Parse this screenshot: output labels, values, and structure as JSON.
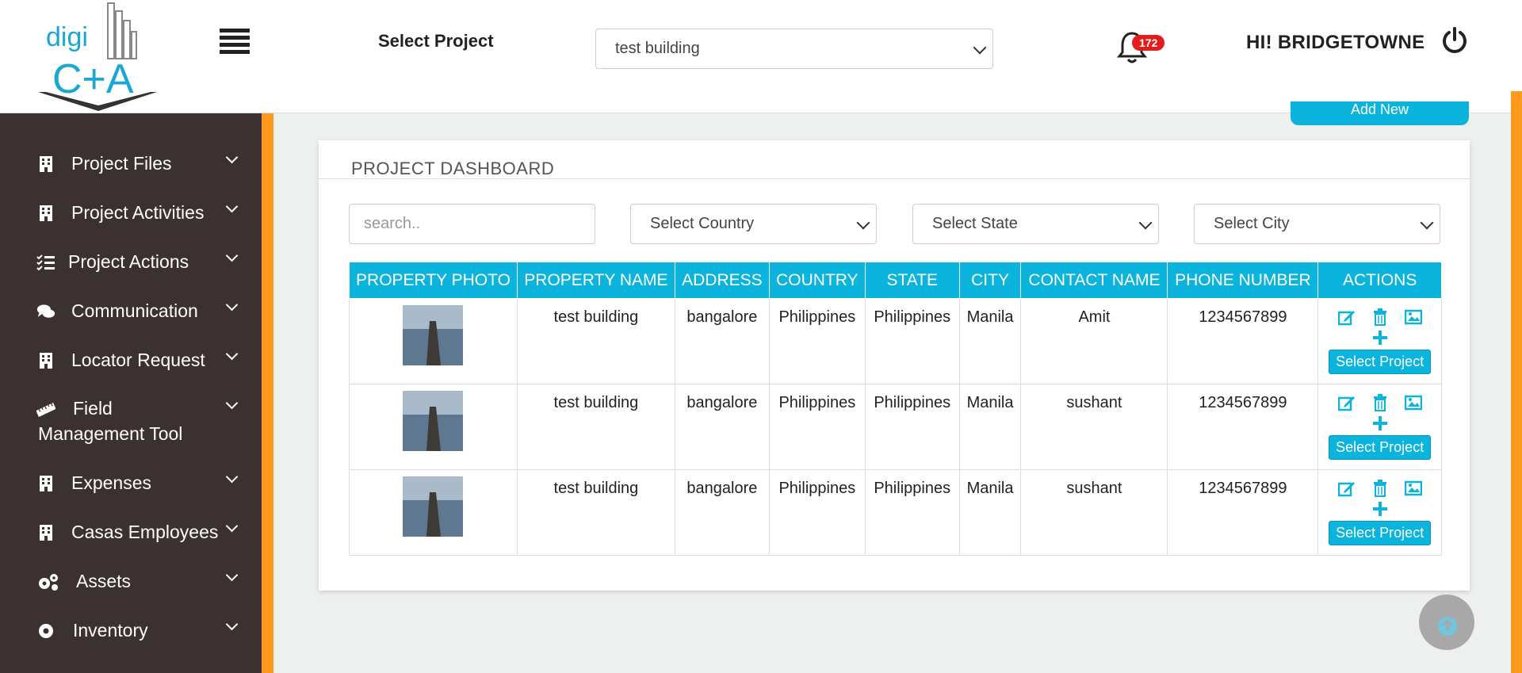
{
  "app": {
    "logo_text_top": "digi",
    "logo_text_bottom": "C+A"
  },
  "header": {
    "select_project_label": "Select Project",
    "project_select_value": "test building",
    "notification_count": "172",
    "greeting": "HI! BRIDGETOWNE"
  },
  "sidebar": {
    "items": [
      {
        "label": "Project Files",
        "icon": "building-icon"
      },
      {
        "label": "Project Activities",
        "icon": "building-icon"
      },
      {
        "label": "Project Actions",
        "icon": "checklist-icon"
      },
      {
        "label": "Communication",
        "icon": "comments-icon"
      },
      {
        "label": "Locator Request",
        "icon": "building-icon"
      },
      {
        "label": "Field Management Tool",
        "icon": "ruler-icon"
      },
      {
        "label": "Expenses",
        "icon": "building-icon"
      },
      {
        "label": "Casas Employees",
        "icon": "building-icon"
      },
      {
        "label": "Assets",
        "icon": "cogs-icon"
      },
      {
        "label": "Inventory",
        "icon": "cog-icon"
      }
    ]
  },
  "main": {
    "add_new_label": "Add New",
    "dashboard_title": "PROJECT DASHBOARD",
    "filters": {
      "search_placeholder": "search..",
      "country": "Select Country",
      "state": "Select State",
      "city": "Select City"
    },
    "table": {
      "columns": [
        "PROPERTY PHOTO",
        "PROPERTY NAME",
        "ADDRESS",
        "COUNTRY",
        "STATE",
        "CITY",
        "CONTACT NAME",
        "PHONE NUMBER",
        "ACTIONS"
      ],
      "rows": [
        {
          "name": "test building",
          "address": "bangalore",
          "country": "Philippines",
          "state": "Philippines",
          "city": "Manila",
          "contact": "Amit",
          "phone": "1234567899"
        },
        {
          "name": "test building",
          "address": "bangalore",
          "country": "Philippines",
          "state": "Philippines",
          "city": "Manila",
          "contact": "sushant",
          "phone": "1234567899"
        },
        {
          "name": "test building",
          "address": "bangalore",
          "country": "Philippines",
          "state": "Philippines",
          "city": "Manila",
          "contact": "sushant",
          "phone": "1234567899"
        }
      ],
      "select_project_button": "Select Project"
    }
  },
  "colors": {
    "accent": "#0ab4dc",
    "sidebar_bg": "#3a3130",
    "orange": "#ff9a1f",
    "badge": "#e51c1c"
  }
}
